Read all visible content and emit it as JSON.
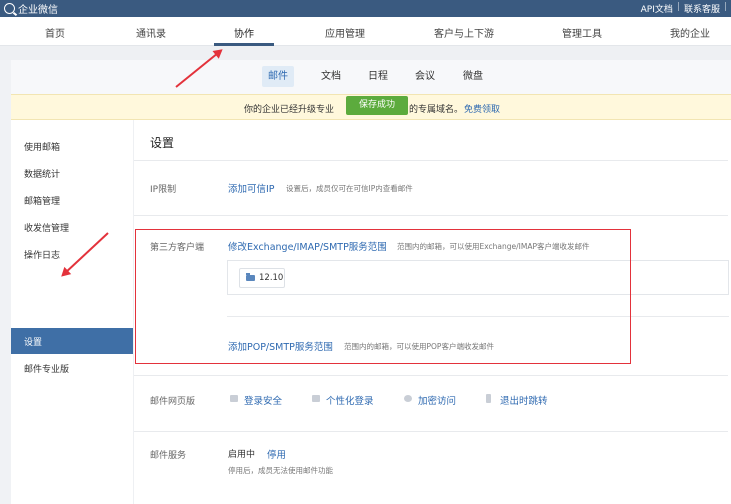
{
  "topbar": {
    "app_name": "企业微信",
    "links": [
      "API文档",
      "联系客服"
    ]
  },
  "nav": {
    "items": [
      "首页",
      "通讯录",
      "协作",
      "应用管理",
      "客户与上下游",
      "管理工具",
      "我的企业"
    ],
    "active_index": 2
  },
  "subtabs": {
    "items": [
      "邮件",
      "文档",
      "日程",
      "会议",
      "微盘"
    ],
    "active_index": 0
  },
  "banner": {
    "text_left": "你的企业已经升级专业",
    "text_right": "的专属域名。",
    "link": "免费领取"
  },
  "toast": "保存成功",
  "sidebar": {
    "items": [
      "使用邮箱",
      "数据统计",
      "邮箱管理",
      "收发信管理",
      "操作日志",
      "设置",
      "邮件专业版"
    ],
    "active_index": 5
  },
  "settings": {
    "title": "设置",
    "ip_limit": {
      "label": "IP限制",
      "link": "添加可信IP",
      "note": "设置后，成员仅可在可信IP内查看邮件"
    },
    "third_party": {
      "label": "第三方客户端",
      "link_exchange": "修改Exchange/IMAP/SMTP服务范围",
      "note_exchange": "范围内的邮箱，可以使用Exchange/IMAP客户端收发邮件",
      "chip_label": "12.10",
      "link_pop": "添加POP/SMTP服务范围",
      "note_pop": "范围内的邮箱，可以使用POP客户端收发邮件"
    },
    "webmail": {
      "label": "邮件网页版",
      "options": [
        "登录安全",
        "个性化登录",
        "加密访问",
        "退出时跳转"
      ]
    },
    "service": {
      "label": "邮件服务",
      "status": "启用中",
      "action": "停用",
      "note": "停用后，成员无法使用邮件功能"
    }
  },
  "colors": {
    "topbar": "#3a5a80",
    "accent": "#2f6ab1",
    "sidebar_active": "#3f6fa6",
    "toast": "#5cab3d",
    "highlight": "#e3323b"
  }
}
